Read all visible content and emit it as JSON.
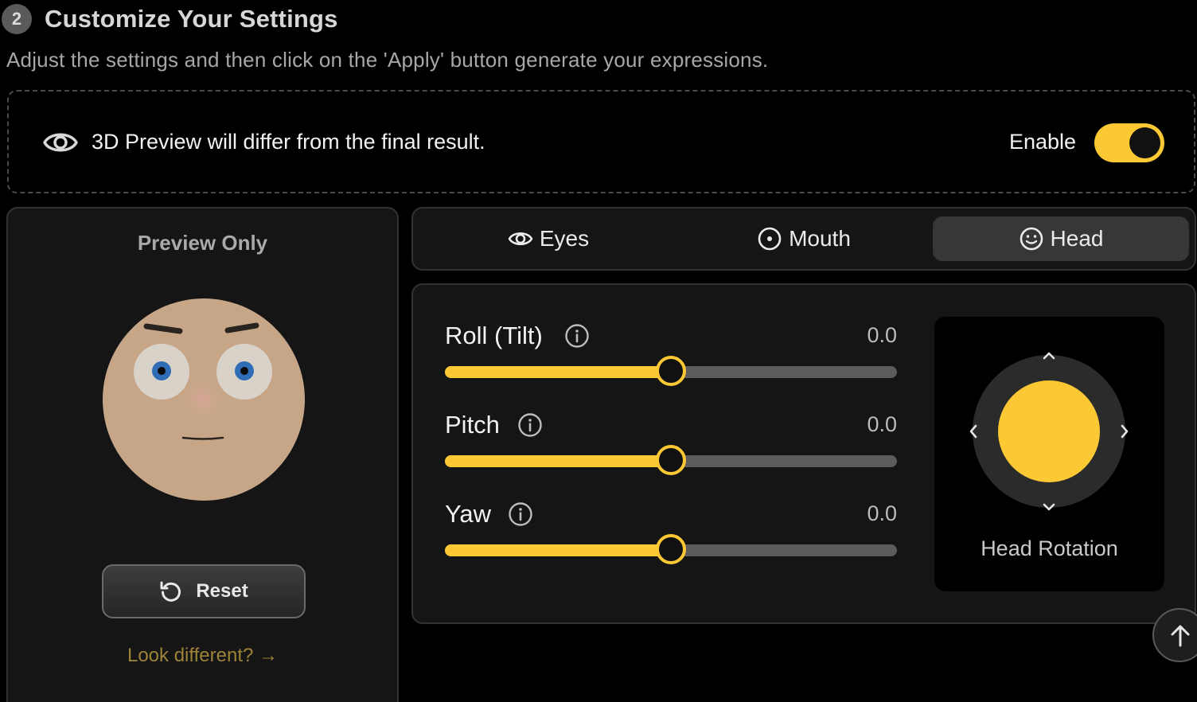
{
  "header": {
    "step_number": "2",
    "title": "Customize Your Settings",
    "subtitle": "Adjust the settings and then click on the 'Apply' button generate your expressions."
  },
  "notice": {
    "icon": "eye-icon",
    "text": "3D Preview will differ from the final result.",
    "enable_label": "Enable",
    "enabled": true
  },
  "preview": {
    "title": "Preview Only",
    "reset_label": "Reset",
    "look_different_label": "Look different? →"
  },
  "tabs": [
    {
      "label": "Eyes",
      "icon": "eye-icon",
      "active": false
    },
    {
      "label": "Mouth",
      "icon": "target-icon",
      "active": false
    },
    {
      "label": "Head",
      "icon": "smiley-icon",
      "active": true
    }
  ],
  "sliders": [
    {
      "label": "Roll (Tilt)",
      "value": "0.0",
      "fill_fraction": 0.5
    },
    {
      "label": "Pitch",
      "value": "0.0",
      "fill_fraction": 0.5
    },
    {
      "label": "Yaw",
      "value": "0.0",
      "fill_fraction": 0.5
    }
  ],
  "joystick": {
    "label": "Head Rotation"
  },
  "colors": {
    "accent": "#fcc934",
    "background": "#000000",
    "card": "#151515",
    "link": "#9c8338",
    "skin": "#c7a688"
  }
}
